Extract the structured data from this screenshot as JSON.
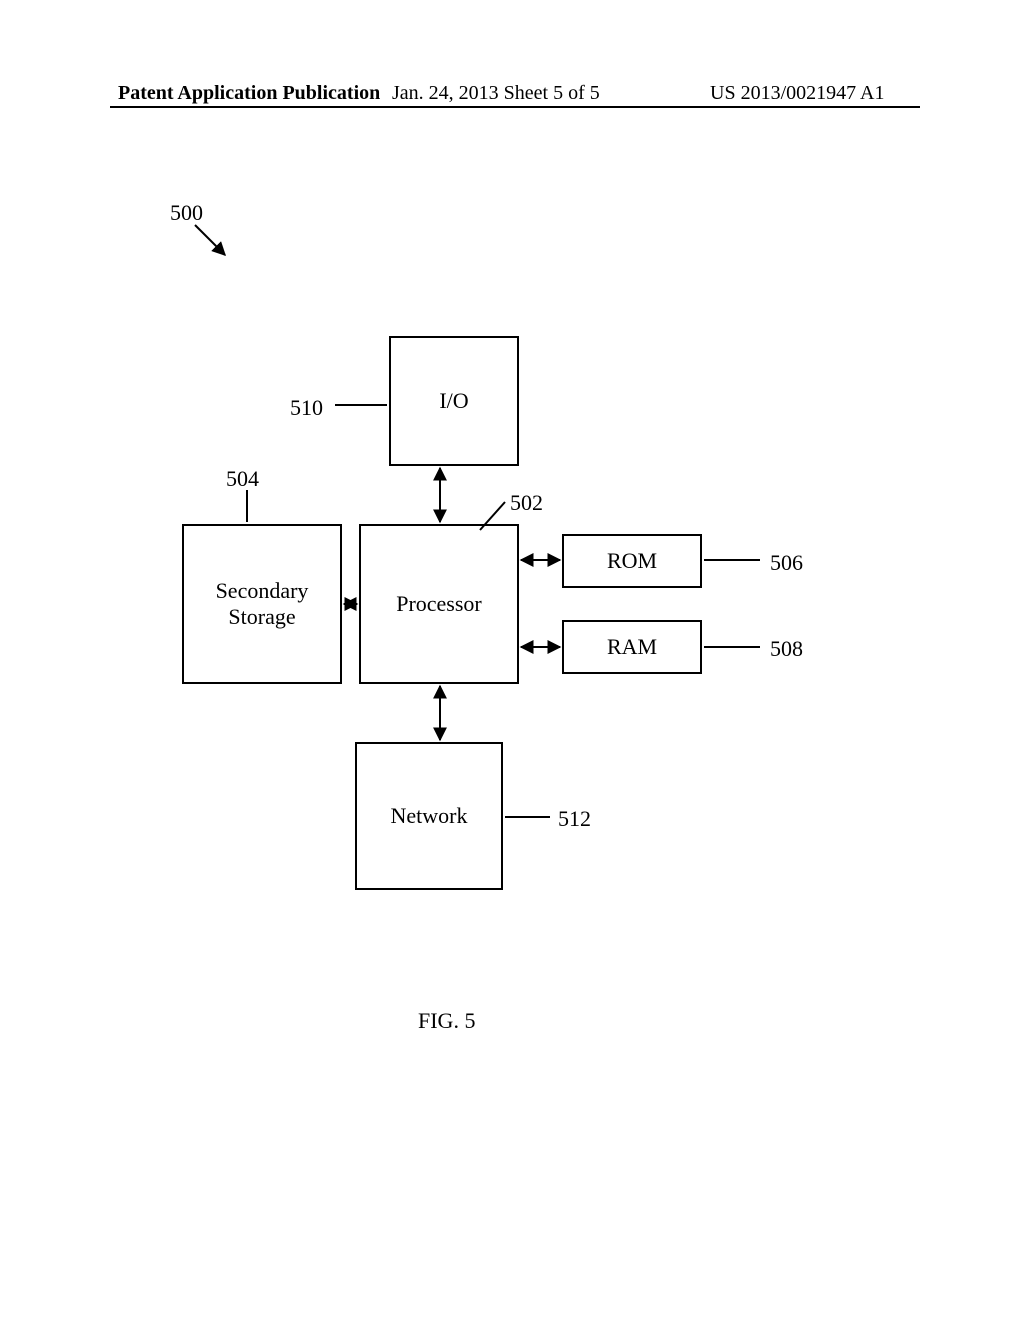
{
  "header": {
    "left": "Patent Application Publication",
    "mid": "Jan. 24, 2013  Sheet 5 of 5",
    "right": "US 2013/0021947 A1"
  },
  "refs": {
    "r500": "500",
    "r510": "510",
    "r504": "504",
    "r502": "502",
    "r506": "506",
    "r508": "508",
    "r512": "512"
  },
  "boxes": {
    "io": "I/O",
    "processor": "Processor",
    "secondary": "Secondary\nStorage",
    "rom": "ROM",
    "ram": "RAM",
    "network": "Network"
  },
  "caption": "FIG. 5"
}
